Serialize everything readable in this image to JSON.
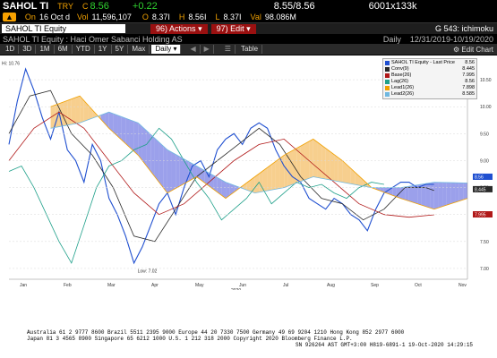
{
  "quote": {
    "ticker": "SAHOL TI",
    "currency": "TRY",
    "last_prefix": "C",
    "last": "8.56",
    "change": "+0.22",
    "bid_ask": "8.55/8.56",
    "size": "6001x133k",
    "date_label": "On",
    "date": "16 Oct d",
    "vol_label": "Vol",
    "vol": "11,596,107",
    "open_label": "O",
    "open": "8.37I",
    "high_label": "H",
    "high": "8.56I",
    "low_label": "L",
    "low": "8.37I",
    "val_label": "Val",
    "val": "98.086M"
  },
  "command_bar": {
    "security": "SAHOL TI Equity",
    "actions_num": "96)",
    "actions": "Actions",
    "edit_num": "97)",
    "edit": "Edit",
    "function_label": "G 543: ichimoku"
  },
  "title_bar": {
    "title": "SAHOL TI Equity : Haci Omer Sabanci Holding AS",
    "period": "Daily",
    "date_range": "12/31/2019-10/19/2020"
  },
  "tabs": {
    "ranges": [
      "1D",
      "3D",
      "1M",
      "6M",
      "YTD",
      "1Y",
      "5Y",
      "Max"
    ],
    "frequency": "Daily",
    "table": "Table",
    "edit_chart": "Edit Chart"
  },
  "legend": {
    "entries": [
      {
        "name": "SAHOL TI Equity - Last Price",
        "value": "8.56",
        "color": "#1f4fd0"
      },
      {
        "name": "Conv(9)",
        "value": "8.445",
        "color": "#2a2a2a"
      },
      {
        "name": "Base(26)",
        "value": "7.995",
        "color": "#b01818"
      },
      {
        "name": "Lag(26)",
        "value": "8.56",
        "color": "#1fa08a"
      },
      {
        "name": "Lead1(26)",
        "value": "7.898",
        "color": "#f0a000"
      },
      {
        "name": "Lead2(26)",
        "value": "8.585",
        "color": "#70b8e0"
      }
    ]
  },
  "chart_data": {
    "type": "line",
    "title": "",
    "x_labels": [
      "Jan",
      "Feb",
      "Mar",
      "Apr",
      "May",
      "Jun",
      "Jul",
      "Aug",
      "Sep",
      "Oct",
      "Nov"
    ],
    "x_year": "2020",
    "y_ticks": [
      7.0,
      7.5,
      8.0,
      8.5,
      9.0,
      9.5,
      10.0,
      10.5
    ],
    "ylim": [
      6.8,
      10.85
    ],
    "hi_label": "Hi: 10.76",
    "low_label": "Low: 7.02",
    "price_tags": [
      {
        "value": "8.56",
        "color": "#1f4fd0"
      },
      {
        "value": "8.445",
        "color": "#2a2a2a"
      },
      {
        "value": "7.995",
        "color": "#b01818"
      }
    ],
    "series": [
      {
        "name": "Last Price",
        "color": "#1f4fd0",
        "x": [
          0,
          4,
          8,
          12,
          16,
          20,
          24,
          28,
          32,
          36,
          40,
          44,
          48,
          52,
          56,
          60,
          64,
          68,
          72,
          76,
          80,
          84,
          88,
          92,
          96,
          100,
          104,
          108,
          112,
          116,
          120,
          124,
          128,
          132,
          136,
          140,
          144,
          148,
          152,
          156,
          160,
          164,
          168,
          172,
          176,
          180,
          184,
          188,
          192,
          196,
          200,
          204
        ],
        "y": [
          9.3,
          10.1,
          10.7,
          10.3,
          9.8,
          9.4,
          9.9,
          9.2,
          9.0,
          8.6,
          9.3,
          9.0,
          8.3,
          8.0,
          7.6,
          7.1,
          7.4,
          7.8,
          8.2,
          8.4,
          8.0,
          8.5,
          8.9,
          9.0,
          8.7,
          9.2,
          9.4,
          9.5,
          9.3,
          9.6,
          9.7,
          9.6,
          9.2,
          8.9,
          8.7,
          8.6,
          8.3,
          8.2,
          8.1,
          8.3,
          8.2,
          8.0,
          7.9,
          7.7,
          8.1,
          8.4,
          8.5,
          8.6,
          8.6,
          8.5,
          8.56,
          8.56
        ]
      },
      {
        "name": "Conv(9)",
        "color": "#2a2a2a",
        "x": [
          0,
          10,
          20,
          30,
          40,
          50,
          60,
          70,
          80,
          90,
          100,
          110,
          120,
          130,
          140,
          150,
          160,
          170,
          180,
          190,
          200,
          204
        ],
        "y": [
          9.5,
          10.2,
          10.3,
          9.5,
          9.1,
          8.5,
          7.6,
          7.5,
          8.1,
          8.7,
          9.0,
          9.3,
          9.6,
          9.3,
          8.7,
          8.3,
          8.2,
          7.9,
          8.1,
          8.5,
          8.5,
          8.445
        ]
      },
      {
        "name": "Base(26)",
        "color": "#b01818",
        "x": [
          0,
          12,
          24,
          36,
          48,
          60,
          72,
          84,
          96,
          108,
          120,
          132,
          144,
          156,
          168,
          180,
          192,
          204
        ],
        "y": [
          9.0,
          9.6,
          9.9,
          9.6,
          9.0,
          8.4,
          8.0,
          8.2,
          8.6,
          9.0,
          9.3,
          9.4,
          9.0,
          8.6,
          8.2,
          8.0,
          7.95,
          7.995
        ]
      },
      {
        "name": "Lag(26)",
        "color": "#1fa08a",
        "x": [
          0,
          6,
          12,
          18,
          24,
          30,
          36,
          42,
          48,
          54,
          60,
          66,
          72,
          78,
          84,
          90,
          96,
          102,
          108,
          114,
          120,
          126,
          132,
          138,
          144,
          150,
          156,
          162,
          168,
          174,
          180
        ],
        "y": [
          8.8,
          8.9,
          8.5,
          8.0,
          7.5,
          7.1,
          7.8,
          8.5,
          8.9,
          9.0,
          9.2,
          9.3,
          9.6,
          9.4,
          9.0,
          8.6,
          8.3,
          7.9,
          8.1,
          8.3,
          8.6,
          8.2,
          8.4,
          8.6,
          8.5,
          8.56,
          8.4,
          8.3,
          8.5,
          8.6,
          8.56
        ]
      },
      {
        "name": "Lead1(26)",
        "color": "#f0a000",
        "x": [
          20,
          34,
          48,
          62,
          76,
          90,
          104,
          118,
          132,
          146,
          160,
          174,
          188,
          204,
          220
        ],
        "y": [
          10.0,
          10.2,
          9.6,
          9.1,
          8.4,
          8.7,
          8.3,
          8.7,
          9.1,
          9.4,
          9.0,
          8.5,
          8.3,
          8.1,
          8.3
        ]
      },
      {
        "name": "Lead2(26)",
        "color": "#70b8e0",
        "x": [
          20,
          34,
          48,
          62,
          76,
          90,
          104,
          118,
          132,
          146,
          160,
          174,
          188,
          204,
          220
        ],
        "y": [
          9.6,
          9.7,
          9.9,
          9.7,
          9.2,
          8.9,
          8.6,
          8.4,
          8.5,
          8.7,
          8.6,
          8.5,
          8.5,
          8.6,
          8.585
        ]
      }
    ]
  },
  "footer": {
    "line1": "Australia 61 2 9777 8600 Brazil 5511 2395 9000 Europe 44 20 7330 7500 Germany 49 69 9204 1210 Hong Kong 852 2977 6000",
    "line2": "Japan 81 3 4565 8900       Singapore 65 6212 1000       U.S. 1 212 318 2000          Copyright 2020 Bloomberg Finance L.P.",
    "line3": "SN 926264 AST  GMT+3:00 H819-6891-1 19-Oct-2020 14:29:15"
  }
}
